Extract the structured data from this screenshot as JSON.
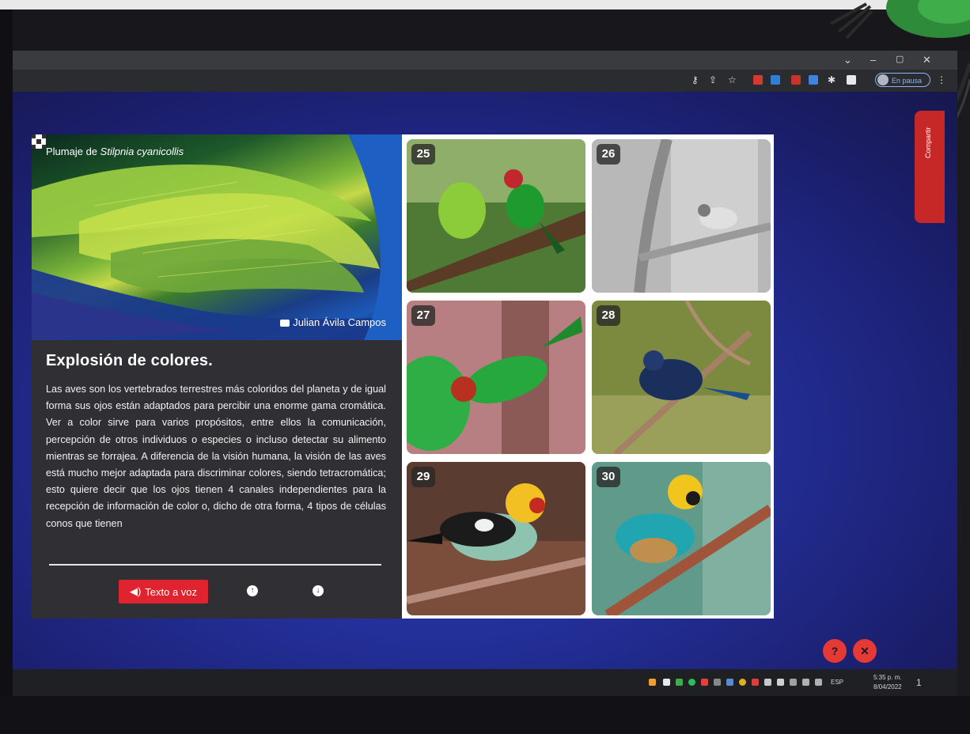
{
  "browser": {
    "window_controls": [
      "⌄",
      "–",
      "▢",
      "✕"
    ],
    "profile_status": "En pausa"
  },
  "hero": {
    "caption_prefix": "Plumaje de ",
    "caption_species": "Stilpnia cyanicollis",
    "credit": "Julian Ávila Campos"
  },
  "article": {
    "heading": "Explosión de colores.",
    "body": "Las aves son los vertebrados terrestres más coloridos del planeta y de igual forma sus ojos están adaptados para percibir una enorme gama cromática. Ver a color sirve para varios propósitos, entre ellos la comunicación, percepción de otros individuos o especies o incluso detectar su alimento mientras se forrajea. A diferencia de la visión humana, la visión de las aves está mucho mejor adaptada para discriminar colores, siendo tetracromática; esto quiere decir que los ojos tienen 4 canales independientes para la recepción de información de color o, dicho de otra forma, 4 tipos de células conos que tienen"
  },
  "controls": {
    "tts_label": "Texto a voz",
    "up_icon": "↑",
    "down_icon": "↓"
  },
  "gallery": {
    "items": [
      {
        "number": "25"
      },
      {
        "number": "26"
      },
      {
        "number": "27"
      },
      {
        "number": "28"
      },
      {
        "number": "29"
      },
      {
        "number": "30"
      }
    ]
  },
  "side_tab": {
    "label": "Compartir"
  },
  "fabs": {
    "help": "?",
    "tools": "✕"
  },
  "taskbar": {
    "language": "ESP",
    "time": "5:35 p. m.",
    "date": "8/04/2022",
    "notifications": "1"
  },
  "colors": {
    "accent_red": "#e0242f",
    "panel": "#2f2f34",
    "page_blue": "#23309a"
  }
}
